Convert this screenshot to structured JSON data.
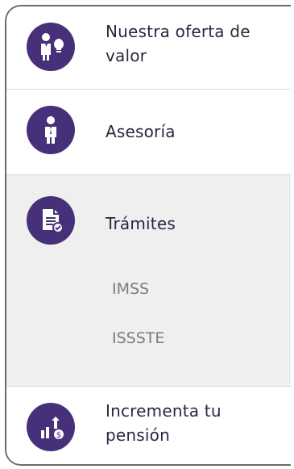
{
  "menu": {
    "items": [
      {
        "label_line1": "Nuestra oferta de",
        "label_line2": "valor",
        "icon": "advisor-idea-icon"
      },
      {
        "label": "Asesoría",
        "icon": "advisor-person-icon"
      },
      {
        "label": "Trámites",
        "icon": "document-check-icon",
        "subitems": [
          "IMSS",
          "ISSSTE"
        ]
      },
      {
        "label_line1": "Incrementa tu",
        "label_line2": "pensión",
        "icon": "growth-money-icon"
      }
    ]
  },
  "colors": {
    "icon_bg": "#47307a",
    "text_primary": "#2d2640",
    "text_secondary": "#7b7b86",
    "active_bg": "#efefef",
    "border": "#6b6b6b"
  }
}
